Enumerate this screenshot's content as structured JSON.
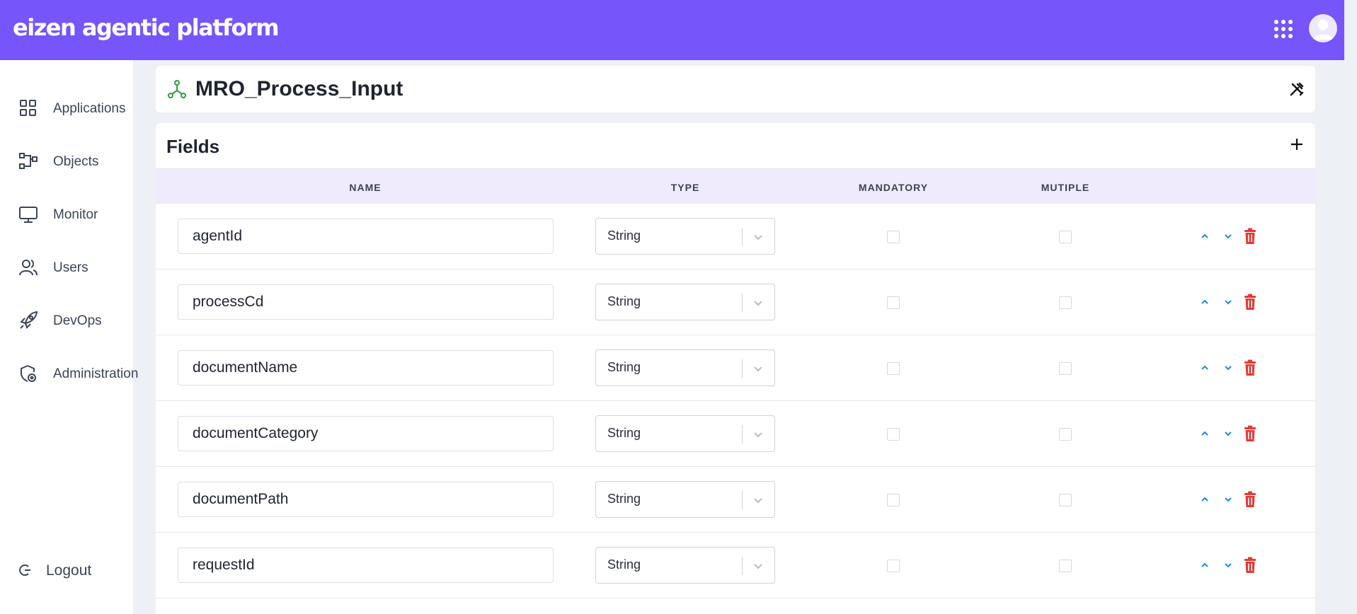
{
  "app": {
    "brand": "eizen agentic platform"
  },
  "sidebar": {
    "items": [
      {
        "label": "Applications",
        "icon": "grid-icon"
      },
      {
        "label": "Objects",
        "icon": "objects-icon"
      },
      {
        "label": "Monitor",
        "icon": "monitor-icon"
      },
      {
        "label": "Users",
        "icon": "users-icon"
      },
      {
        "label": "DevOps",
        "icon": "rocket-icon"
      },
      {
        "label": "Administration",
        "icon": "shield-gear-icon"
      }
    ],
    "logout_label": "Logout"
  },
  "object": {
    "title": "MRO_Process_Input"
  },
  "fields": {
    "section_title": "Fields",
    "columns": {
      "name": "NAME",
      "type": "TYPE",
      "mandatory": "MANDATORY",
      "multiple": "MUTIPLE"
    },
    "rows": [
      {
        "name": "agentId",
        "type": "String",
        "mandatory": false,
        "multiple": false
      },
      {
        "name": "processCd",
        "type": "String",
        "mandatory": false,
        "multiple": false
      },
      {
        "name": "documentName",
        "type": "String",
        "mandatory": false,
        "multiple": false
      },
      {
        "name": "documentCategory",
        "type": "String",
        "mandatory": false,
        "multiple": false
      },
      {
        "name": "documentPath",
        "type": "String",
        "mandatory": false,
        "multiple": false
      },
      {
        "name": "requestId",
        "type": "String",
        "mandatory": false,
        "multiple": false
      }
    ]
  },
  "colors": {
    "brand": "#7655fa",
    "header_row": "#efebfd",
    "delete": "#e53935",
    "arrow": "#1e88e5",
    "object_icon": "#2e9d3a"
  }
}
